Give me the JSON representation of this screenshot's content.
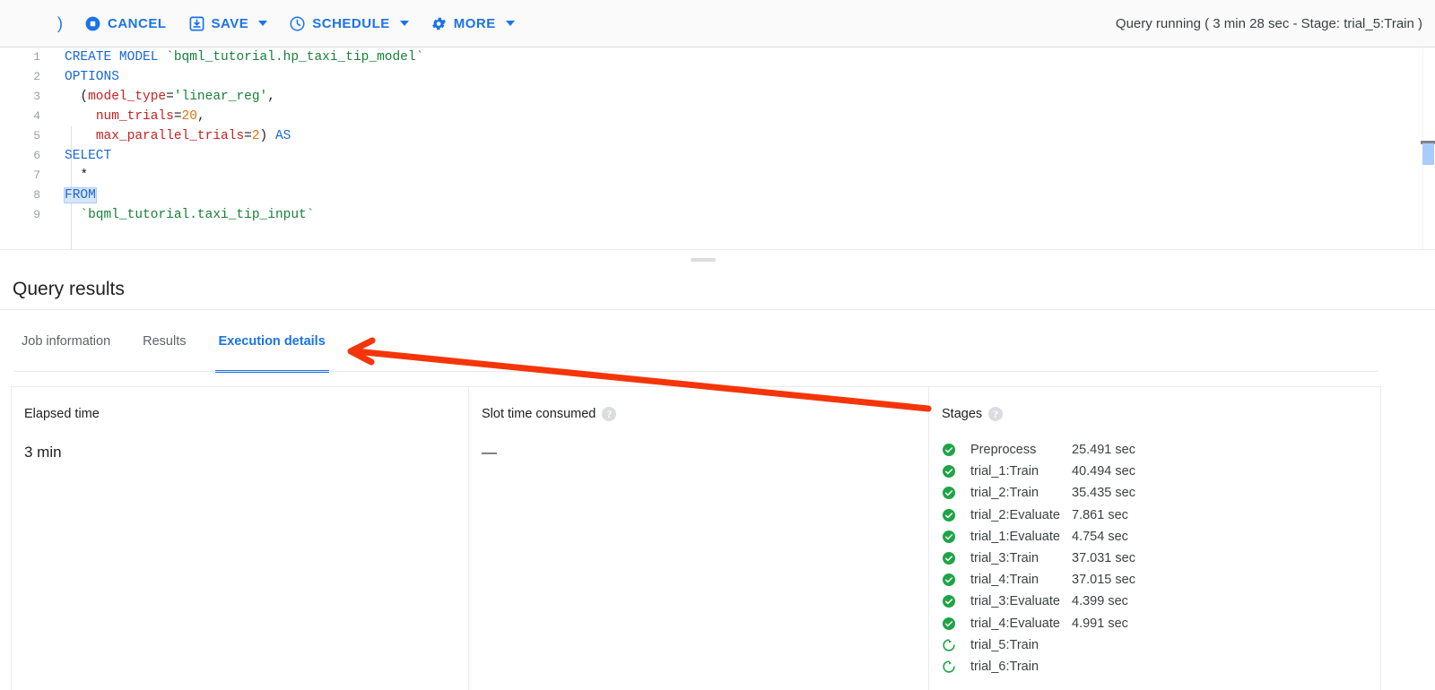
{
  "toolbar": {
    "paren": ")",
    "buttons": [
      {
        "label": "CANCEL",
        "icon": "stop-circle-icon",
        "caret": false
      },
      {
        "label": "SAVE",
        "icon": "save-icon",
        "caret": true
      },
      {
        "label": "SCHEDULE",
        "icon": "clock-icon",
        "caret": true
      },
      {
        "label": "MORE",
        "icon": "gear-icon",
        "caret": true
      }
    ],
    "status": "Query running ( 3 min 28 sec - Stage: trial_5:Train )"
  },
  "editor": {
    "line_numbers": [
      "1",
      "2",
      "3",
      "4",
      "5",
      "6",
      "7",
      "8",
      "9"
    ],
    "lines": [
      "CREATE MODEL `bqml_tutorial.hp_taxi_tip_model`",
      "OPTIONS",
      "  (model_type='linear_reg',",
      "    num_trials=20,",
      "    max_parallel_trials=2) AS",
      "SELECT",
      "  *",
      "FROM",
      "  `bqml_tutorial.taxi_tip_input`"
    ],
    "selected_token": "FROM"
  },
  "results": {
    "title": "Query results",
    "tabs": [
      {
        "label": "Job information",
        "active": false
      },
      {
        "label": "Results",
        "active": false
      },
      {
        "label": "Execution details",
        "active": true
      }
    ]
  },
  "panels": {
    "elapsed": {
      "label": "Elapsed time",
      "value": "3 min"
    },
    "slot_time": {
      "label": "Slot time consumed",
      "value": "—",
      "help_icon": "help-circle-icon",
      "help_glyph": "?"
    },
    "stages": {
      "label": "Stages",
      "help_icon": "help-circle-icon",
      "help_glyph": "?",
      "rows": [
        {
          "status": "complete",
          "name": "Preprocess",
          "time": "25.491 sec"
        },
        {
          "status": "complete",
          "name": "trial_1:Train",
          "time": "40.494 sec"
        },
        {
          "status": "complete",
          "name": "trial_2:Train",
          "time": "35.435 sec"
        },
        {
          "status": "complete",
          "name": "trial_2:Evaluate",
          "time": "7.861 sec"
        },
        {
          "status": "complete",
          "name": "trial_1:Evaluate",
          "time": "4.754 sec"
        },
        {
          "status": "complete",
          "name": "trial_3:Train",
          "time": "37.031 sec"
        },
        {
          "status": "complete",
          "name": "trial_4:Train",
          "time": "37.015 sec"
        },
        {
          "status": "complete",
          "name": "trial_3:Evaluate",
          "time": "4.399 sec"
        },
        {
          "status": "complete",
          "name": "trial_4:Evaluate",
          "time": "4.991 sec"
        },
        {
          "status": "running",
          "name": "trial_5:Train",
          "time": ""
        },
        {
          "status": "running",
          "name": "trial_6:Train",
          "time": ""
        }
      ]
    }
  },
  "colors": {
    "accent_blue": "#1a73e8",
    "success_green": "#1ea446",
    "annotation_red": "#f4350a",
    "text_primary": "#202124",
    "text_secondary": "#5f6368"
  },
  "annotation": {
    "type": "arrow",
    "description": "red arrow pointing to Execution details tab"
  }
}
